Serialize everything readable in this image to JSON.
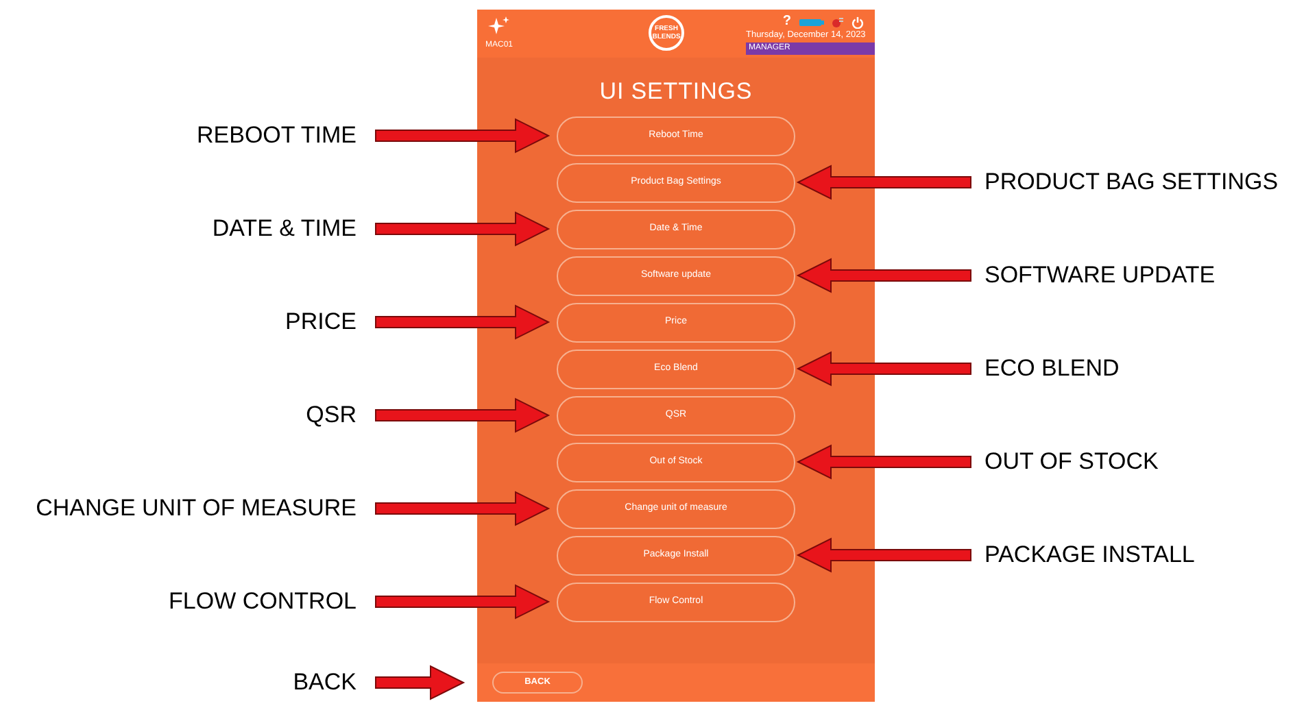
{
  "header": {
    "terminal": "MAC01",
    "logo": "FRESH BLENDS",
    "help": "?",
    "date": "Thursday, December 14, 2023",
    "role": "MANAGER"
  },
  "title": "UI SETTINGS",
  "buttons": [
    {
      "label": "Reboot Time",
      "callout": "REBOOT TIME",
      "kind": "left"
    },
    {
      "label": "Product Bag Settings",
      "callout": "PRODUCT BAG SETTINGS",
      "kind": "right"
    },
    {
      "label": "Date & Time",
      "callout": "DATE & TIME",
      "kind": "left"
    },
    {
      "label": "Software update",
      "callout": "SOFTWARE UPDATE",
      "kind": "right"
    },
    {
      "label": "Price",
      "callout": "PRICE",
      "kind": "left"
    },
    {
      "label": "Eco Blend",
      "callout": "ECO BLEND",
      "kind": "right"
    },
    {
      "label": "QSR",
      "callout": "QSR",
      "kind": "left"
    },
    {
      "label": "Out of Stock",
      "callout": "OUT OF STOCK",
      "kind": "right"
    },
    {
      "label": "Change unit of measure",
      "callout": "CHANGE UNIT OF MEASURE",
      "kind": "left"
    },
    {
      "label": "Package Install",
      "callout": "PACKAGE INSTALL",
      "kind": "right"
    },
    {
      "label": "Flow Control",
      "callout": "FLOW CONTROL",
      "kind": "left"
    }
  ],
  "back": {
    "label": "BACK",
    "callout": "BACK",
    "kind": "edge"
  }
}
